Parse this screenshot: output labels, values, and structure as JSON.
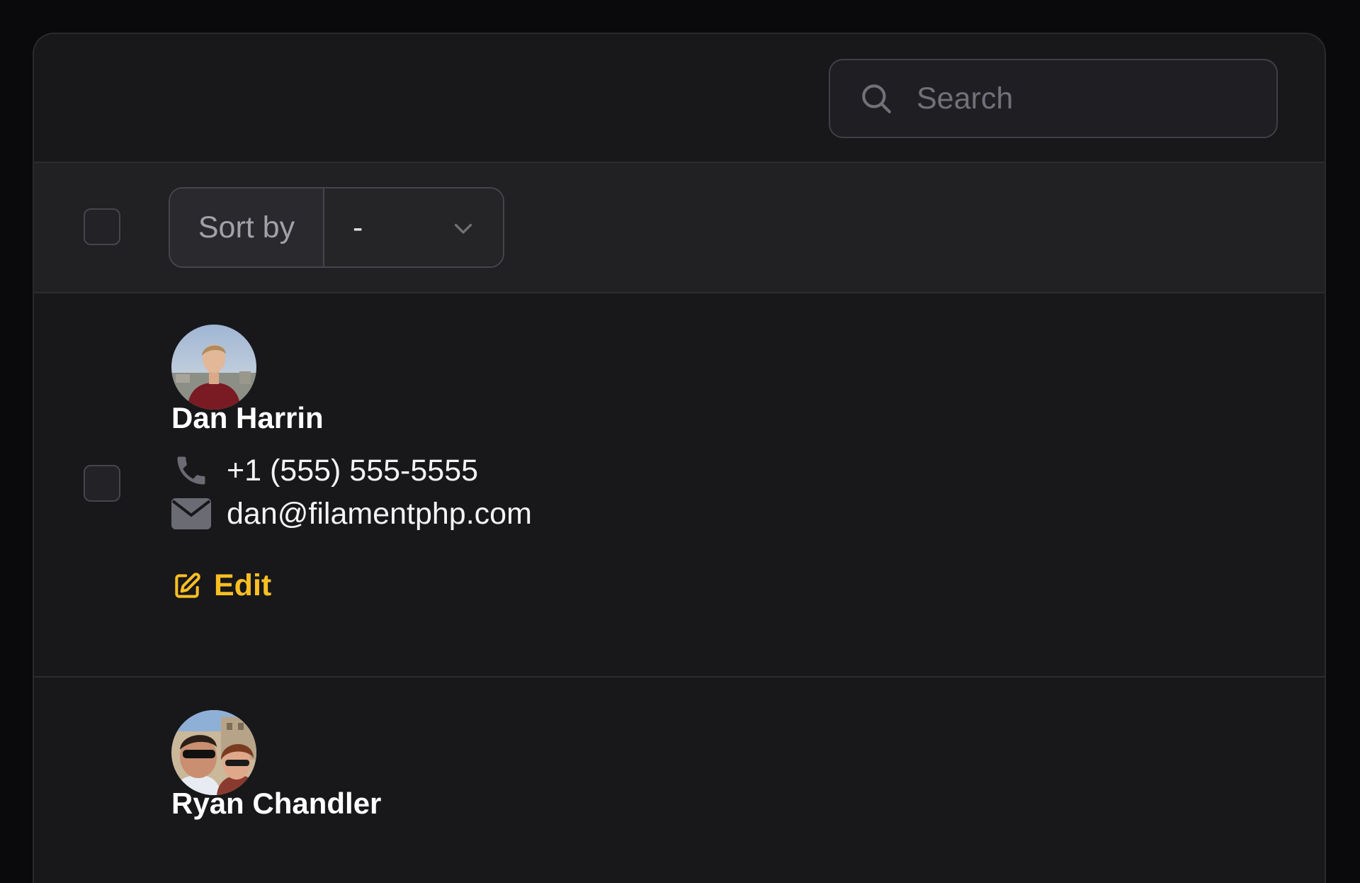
{
  "search": {
    "placeholder": "Search",
    "value": ""
  },
  "sort": {
    "label": "Sort by",
    "value": "-"
  },
  "records": [
    {
      "name": "Dan Harrin",
      "phone": "+1 (555) 555-5555",
      "email": "dan@filamentphp.com",
      "action_label": "Edit",
      "avatar_icon": "avatar-photo"
    },
    {
      "name": "Ryan Chandler",
      "avatar_icon": "avatar-photo"
    }
  ],
  "colors": {
    "accent": "#fbbf24",
    "panel_bg": "#18181b",
    "header_bg": "#212124",
    "muted_text": "#a1a1aa"
  }
}
